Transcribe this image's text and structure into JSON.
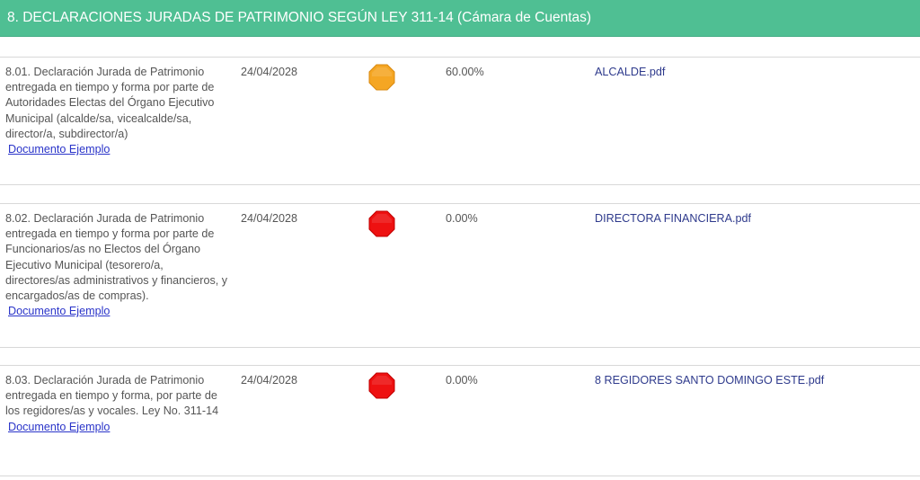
{
  "section": {
    "title": "8. DECLARACIONES JURADAS DE PATRIMONIO SEGÚN LEY 311-14 (Cámara de Cuentas)",
    "color": "#4fbf93"
  },
  "rows": [
    {
      "description": "8.01. Declaración Jurada de Patrimonio entregada en tiempo y forma por parte de Autoridades Electas del Órgano Ejecutivo Municipal (alcalde/sa, vicealcalde/sa, director/a, subdirector/a)",
      "doc_link": "Documento Ejemplo",
      "date": "24/04/2028",
      "status_icon": "orange-octagon-icon",
      "status_color": "#f5a623",
      "percent": "60.00%",
      "file": "ALCALDE.pdf"
    },
    {
      "description": "8.02. Declaración Jurada de Patrimonio entregada en tiempo y forma por parte de Funcionarios/as no Electos del Órgano Ejecutivo Municipal (tesorero/a, directores/as administrativos y financieros, y encargados/as de compras).",
      "doc_link": "Documento Ejemplo",
      "date": "24/04/2028",
      "status_icon": "red-octagon-icon",
      "status_color": "#ee1111",
      "percent": "0.00%",
      "file": "DIRECTORA FINANCIERA.pdf"
    },
    {
      "description": "8.03. Declaración Jurada de Patrimonio entregada en tiempo y forma, por parte de los regidores/as y vocales. Ley No. 311-14",
      "doc_link": "Documento Ejemplo",
      "date": "24/04/2028",
      "status_icon": "red-octagon-icon",
      "status_color": "#ee1111",
      "percent": "0.00%",
      "file": "8 REGIDORES SANTO DOMINGO ESTE.pdf"
    }
  ]
}
